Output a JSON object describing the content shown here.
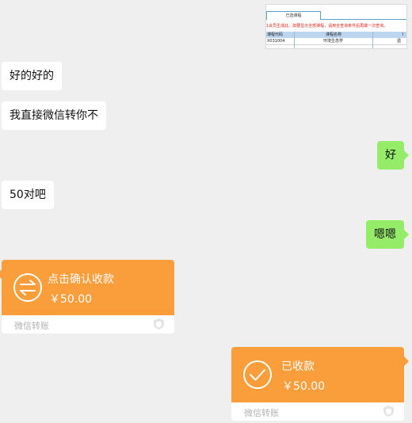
{
  "thumbnail": {
    "tab_label": "已选课程",
    "notice": "1会员生成此。如要显示全部课程，请用全查询条件后再做一次查询。",
    "columns": [
      "课程代码",
      "课程名称",
      "I"
    ],
    "row": [
      "X031004",
      "环境生态学",
      "遗"
    ]
  },
  "messages": [
    {
      "side": "left",
      "text": "好的好的"
    },
    {
      "side": "left",
      "text": "我直接微信转你不"
    },
    {
      "side": "right",
      "text": "好"
    },
    {
      "side": "left",
      "text": "50对吧"
    },
    {
      "side": "right",
      "text": "嗯嗯"
    }
  ],
  "transfers": [
    {
      "direction": "incoming",
      "title": "点击确认收款",
      "amount": "￥50.00",
      "footer": "微信转账",
      "icon": "transfer-arrows-icon"
    },
    {
      "direction": "outgoing",
      "title": "已收款",
      "amount": "￥50.00",
      "footer": "微信转账",
      "icon": "checkmark-icon"
    }
  ],
  "colors": {
    "background": "#efefef",
    "sent_bubble": "#95ec69",
    "received_bubble": "#ffffff",
    "transfer_card": "#fa9d3b"
  }
}
